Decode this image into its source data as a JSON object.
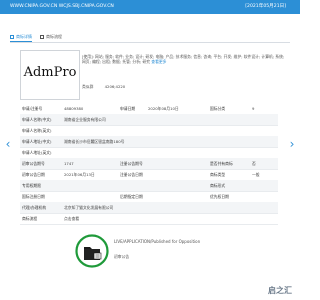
{
  "header": {
    "site_url": "WWW.CNIPA.GOV.CN   WCJS.SBJ.CNIPA.GOV.CN",
    "apply_date": "[2021年05月21日]"
  },
  "tabs": [
    {
      "label": "商标详情"
    },
    {
      "label": "商标流程"
    }
  ],
  "trademark": {
    "mark_text": "AdmPro",
    "goods_services": "[使用]: 网站; 服务; 软件; 业务; 设计; 研发; 电脑; 产品; 技术服务; 信息; 咨询; 平台; 开发; 维护; 软件设计; 计算机; 系统; 网页; 编程; 出租; 数据; 托管; 分析; 研究",
    "more_label": "查看更多",
    "similar_group_label": "类似群",
    "similar_group_value": "4206;4220",
    "category_label": "商品/服务"
  },
  "rows": [
    {
      "c1": "申请/注册号",
      "v1": "48809380",
      "c2": "申请日期",
      "v2": "2020年08月10日",
      "c3": "国际分类",
      "v3": "9"
    },
    {
      "c1": "申请人名称(中文)",
      "v1": "湖南省企业服务有限公司",
      "c2": "",
      "v2": "",
      "c3": "",
      "v3": ""
    },
    {
      "c1": "申请人名称(英文)",
      "v1": "",
      "c2": "",
      "v2": "",
      "c3": "",
      "v3": ""
    },
    {
      "c1": "申请人地址(中文)",
      "v1": "湖南省长沙市岳麓区银盆南路180号",
      "c2": "",
      "v2": "",
      "c3": "",
      "v3": ""
    },
    {
      "c1": "申请人地址(英文)",
      "v1": "",
      "c2": "",
      "v2": "",
      "c3": "",
      "v3": ""
    },
    {
      "c1": "初审公告期号",
      "v1": "1747",
      "c2": "注册公告期号",
      "v2": "",
      "c3": "是否共有商标",
      "v3": "否"
    },
    {
      "c1": "初审公告日期",
      "v1": "2021年06月13日",
      "c2": "注册公告日期",
      "v2": "",
      "c3": "商标类型",
      "v3": "一般"
    },
    {
      "c1": "专用权期限",
      "v1": "",
      "c2": "",
      "v2": "",
      "c3": "商标形式",
      "v3": ""
    },
    {
      "c1": "国际注册日期",
      "v1": "",
      "c2": "后期指定日期",
      "v2": "",
      "c3": "优先权日期",
      "v3": ""
    },
    {
      "c1": "代理/办理机构",
      "v1": "北京知了猫文化发展有限公司",
      "c2": "",
      "v2": "",
      "c3": "",
      "v3": ""
    },
    {
      "c1": "商标流程",
      "v1": "点击查看",
      "c2": "",
      "v2": "",
      "c3": "",
      "v3": ""
    }
  ],
  "status": {
    "text": "LIVE/APPLICATION/Published for Opposition",
    "sub": "初审公告"
  },
  "nav": {
    "prev": "‹",
    "next": "›"
  },
  "watermark": "启之汇",
  "colors": {
    "brand": "#2c8fd6",
    "status_green": "#1f9a3a",
    "row_shade": "#f3f5f7"
  }
}
